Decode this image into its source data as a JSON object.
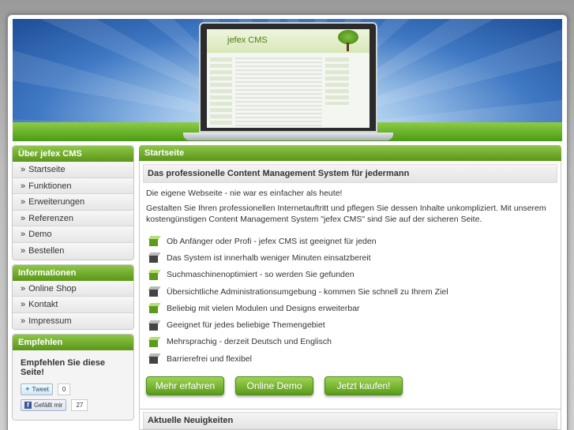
{
  "banner": {
    "screen_title": "jefex CMS"
  },
  "sidebar": {
    "sections": [
      {
        "title": "Über jefex CMS",
        "items": [
          "Startseite",
          "Funktionen",
          "Erweiterungen",
          "Referenzen",
          "Demo",
          "Bestellen"
        ]
      },
      {
        "title": "Informationen",
        "items": [
          "Online Shop",
          "Kontakt",
          "Impressum"
        ]
      }
    ],
    "arrow": "»",
    "empfehlen": {
      "title": "Empfehlen",
      "text": "Empfehlen Sie diese Seite!",
      "tweet_label": "Tweet",
      "tweet_count": "0",
      "like_label": "Gefällt mir",
      "like_count": "27"
    }
  },
  "main": {
    "title": "Startseite",
    "heading": "Das professionelle Content Management System für jedermann",
    "intro": "Die eigene Webseite - nie war es einfacher als heute!",
    "paragraph": "Gestalten Sie Ihren professionellen Internetauftritt und pflegen Sie dessen Inhalte unkompliziert. Mit unserem kostengünstigen Content Management System \"jefex CMS\" sind Sie auf der sicheren Seite.",
    "features": [
      {
        "text": "Ob Anfänger oder Profi - jefex CMS ist geeignet für jeden",
        "icon": "green-cube-icon"
      },
      {
        "text": "Das System ist innerhalb weniger Minuten einsatzbereit",
        "icon": "dark-cube-icon"
      },
      {
        "text": "Suchmaschinenoptimiert - so werden Sie gefunden",
        "icon": "green-cube-icon"
      },
      {
        "text": "Übersichtliche Administrationsumgebung - kommen Sie schnell zu Ihrem Ziel",
        "icon": "dark-cube-icon"
      },
      {
        "text": "Beliebig mit vielen Modulen und Designs erweiterbar",
        "icon": "green-cube-icon"
      },
      {
        "text": "Geeignet für jedes beliebige Themengebiet",
        "icon": "dark-cube-icon"
      },
      {
        "text": "Mehrsprachig - derzeit Deutsch und Englisch",
        "icon": "green-cube-icon"
      },
      {
        "text": "Barrierefrei und flexibel",
        "icon": "dark-cube-icon"
      }
    ],
    "buttons": {
      "more": "Mehr erfahren",
      "demo": "Online Demo",
      "buy": "Jetzt kaufen!"
    }
  },
  "news": {
    "title": "Aktuelle Neuigkeiten"
  },
  "colors": {
    "accent_green": "#6fae2b",
    "banner_blue": "#3f78c3"
  }
}
